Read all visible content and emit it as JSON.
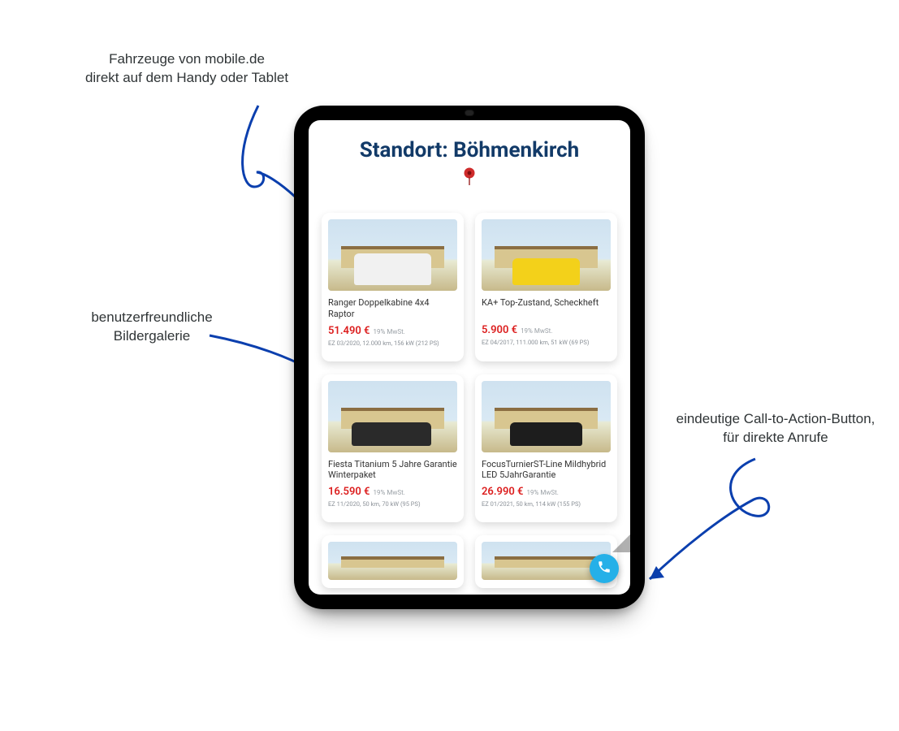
{
  "annotations": {
    "top": "Fahrzeuge von mobile.de\ndirekt auf dem Handy oder Tablet",
    "mid": "benutzerfreundliche\nBildergalerie",
    "right": "eindeutige Call-to-Action-Button,\nfür direkte Anrufe"
  },
  "page": {
    "title": "Standort: Böhmenkirch"
  },
  "cars": [
    {
      "name": "Ranger Doppelkabine 4x4 Raptor",
      "price": "51.490 €",
      "tax": "19% MwSt.",
      "meta": "EZ 03/2020, 12.000 km, 156 kW (212 PS)",
      "color": "white"
    },
    {
      "name": "KA+ Top-Zustand, Scheckheft",
      "price": "5.900 €",
      "tax": "19% MwSt.",
      "meta": "EZ 04/2017, 111.000 km, 51 kW (69 PS)",
      "color": "yellow"
    },
    {
      "name": "Fiesta Titanium 5 Jahre Garantie Winterpaket",
      "price": "16.590 €",
      "tax": "19% MwSt.",
      "meta": "EZ 11/2020, 50 km, 70 kW (95 PS)",
      "color": "dark"
    },
    {
      "name": "FocusTurnierST-Line Mildhybrid LED 5JahrGarantie",
      "price": "26.990 €",
      "tax": "19% MwSt.",
      "meta": "EZ 01/2021, 50 km, 114 kW (155 PS)",
      "color": "dark2"
    }
  ]
}
